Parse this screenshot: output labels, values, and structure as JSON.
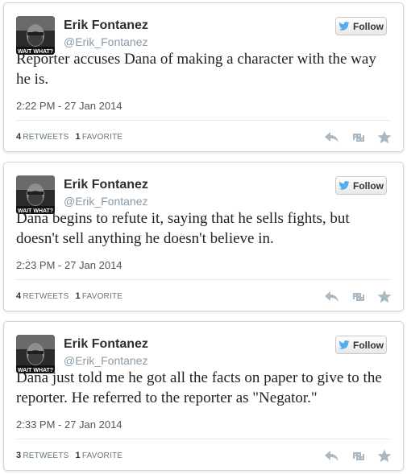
{
  "follow_label": "Follow",
  "tweets": [
    {
      "name": "Erik Fontanez",
      "handle": "@Erik_Fontanez",
      "text": "Reporter accuses Dana of making a character with the way he is.",
      "timestamp": "2:22 PM - 27 Jan 2014",
      "retweets": "4",
      "retweets_label": "RETWEETS",
      "favorites": "1",
      "favorites_label": "FAVORITE"
    },
    {
      "name": "Erik Fontanez",
      "handle": "@Erik_Fontanez",
      "text": "Dana begins to refute it, saying that he sells fights, but doesn't sell anything he doesn't believe in.",
      "timestamp": "2:23 PM - 27 Jan 2014",
      "retweets": "4",
      "retweets_label": "RETWEETS",
      "favorites": "1",
      "favorites_label": "FAVORITE"
    },
    {
      "name": "Erik Fontanez",
      "handle": "@Erik_Fontanez",
      "text": "Dana just told me he got all the facts on paper to give to the reporter. He referred to the reporter as \"Negator.\"",
      "timestamp": "2:33 PM - 27 Jan 2014",
      "retweets": "3",
      "retweets_label": "RETWEETS",
      "favorites": "1",
      "favorites_label": "FAVORITE"
    }
  ],
  "avatar_caption": "WAIT WHAT?",
  "colors": {
    "twitter_blue": "#55acee",
    "action_gray": "#aab8c2"
  }
}
